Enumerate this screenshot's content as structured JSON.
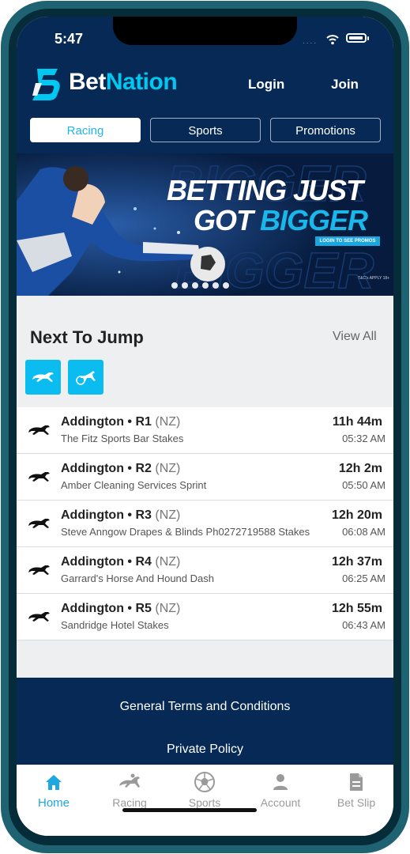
{
  "status_bar": {
    "time": "5:47",
    "signal": "....",
    "wifi_icon": "wifi-icon",
    "battery_icon": "battery-icon"
  },
  "brand": {
    "name_bet": "Bet",
    "name_nation": "Nation",
    "accent": "#00c8f0",
    "header_bg": "#062a55"
  },
  "header": {
    "login_label": "Login",
    "join_label": "Join"
  },
  "tabs": [
    {
      "label": "Racing",
      "active": true
    },
    {
      "label": "Sports",
      "active": false
    },
    {
      "label": "Promotions",
      "active": false
    }
  ],
  "banner": {
    "headline_line1": "BETTING JUST",
    "headline_line2_a": "GOT ",
    "headline_line2_b": "BIGGER",
    "cta": "LOGIN TO SEE PROMOS",
    "terms": "T&C's APPLY 18+",
    "slide_count": 6
  },
  "next_to_jump": {
    "title": "Next To Jump",
    "view_all": "View All",
    "filters": [
      {
        "icon": "greyhound-icon"
      },
      {
        "icon": "harness-icon"
      }
    ],
    "races": [
      {
        "venue": "Addington",
        "race": "R1",
        "country": "(NZ)",
        "name": "The Fitz Sports Bar Stakes",
        "countdown": "11h 44m",
        "time": "05:32 AM"
      },
      {
        "venue": "Addington",
        "race": "R2",
        "country": "(NZ)",
        "name": "Amber Cleaning Services Sprint",
        "countdown": "12h 2m",
        "time": "05:50 AM"
      },
      {
        "venue": "Addington",
        "race": "R3",
        "country": "(NZ)",
        "name": "Steve Anngow Drapes & Blinds Ph0272719588 Stakes",
        "countdown": "12h 20m",
        "time": "06:08 AM"
      },
      {
        "venue": "Addington",
        "race": "R4",
        "country": "(NZ)",
        "name": "Garrard's Horse And Hound Dash",
        "countdown": "12h 37m",
        "time": "06:25 AM"
      },
      {
        "venue": "Addington",
        "race": "R5",
        "country": "(NZ)",
        "name": "Sandridge Hotel Stakes",
        "countdown": "12h 55m",
        "time": "06:43 AM"
      }
    ]
  },
  "footer": {
    "terms": "General Terms and Conditions",
    "privacy": "Private Policy"
  },
  "tabbar": [
    {
      "label": "Home",
      "icon": "home-icon",
      "active": true
    },
    {
      "label": "Racing",
      "icon": "horse-racing-icon",
      "active": false
    },
    {
      "label": "Sports",
      "icon": "soccer-ball-icon",
      "active": false
    },
    {
      "label": "Account",
      "icon": "person-icon",
      "active": false
    },
    {
      "label": "Bet Slip",
      "icon": "document-icon",
      "active": false
    }
  ]
}
